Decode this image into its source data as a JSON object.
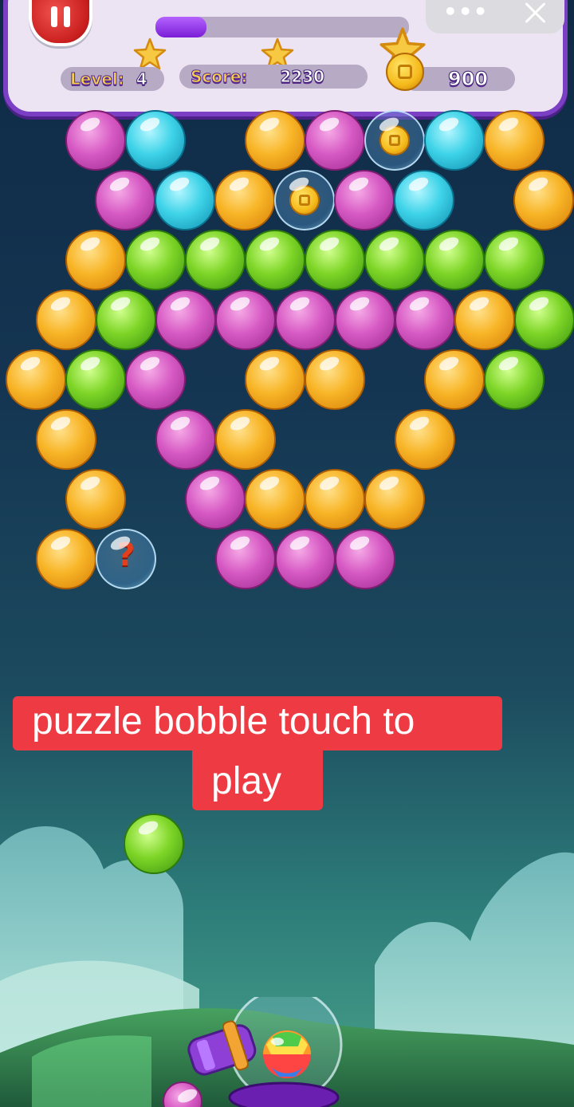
{
  "hud": {
    "level_label": "Level:",
    "level_value": "4",
    "score_label": "Score:",
    "score_value": "2230",
    "coins_value": "900",
    "progress_fraction": 0.2,
    "stars": [
      "star-icon",
      "star-icon",
      "star-icon"
    ]
  },
  "mini_program_menu": {
    "more_icon": "more-dots-icon",
    "close_icon": "close-icon"
  },
  "board": {
    "colors": {
      "pink": "#d75ac4",
      "cyan": "#3ed3e8",
      "orange": "#f8b527",
      "green": "#7ed527"
    },
    "rows": [
      [
        "pink",
        "cyan",
        "",
        "orange",
        "pink",
        "coin",
        "cyan",
        "orange",
        ""
      ],
      [
        "pink",
        "cyan",
        "orange",
        "coin",
        "pink",
        "cyan",
        "",
        "orange"
      ],
      [
        "orange",
        "green",
        "green",
        "green",
        "green",
        "green",
        "green",
        "green",
        ""
      ],
      [
        "orange",
        "green",
        "pink",
        "pink",
        "pink",
        "pink",
        "pink",
        "orange",
        "green"
      ],
      [
        "orange",
        "green",
        "pink",
        "",
        "orange",
        "orange",
        "",
        "orange",
        "green"
      ],
      [
        "orange",
        "",
        "pink",
        "orange",
        "",
        "",
        "orange",
        ""
      ],
      [
        "orange",
        "",
        "pink",
        "orange",
        "orange",
        "orange",
        "",
        ""
      ],
      [
        "orange",
        "mystery",
        "",
        "pink",
        "pink",
        "pink",
        "",
        ""
      ]
    ],
    "mystery_symbol": "?"
  },
  "next_bubble": "green",
  "loaded_bubble": "rainbow",
  "caption": {
    "line1": "puzzle bobble touch to",
    "line2": "play"
  }
}
